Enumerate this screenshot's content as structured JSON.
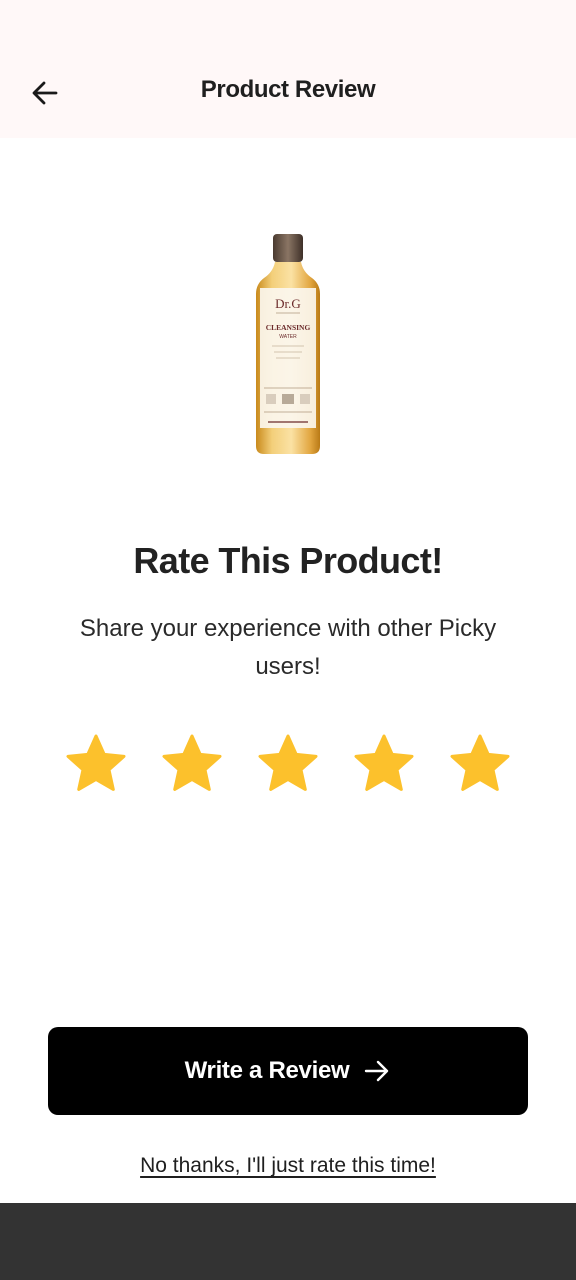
{
  "header": {
    "title": "Product Review",
    "back_icon": "arrow-left-icon"
  },
  "product": {
    "brand": "Dr.G",
    "name_line1": "CLEANSING",
    "name_line2": "WATER",
    "image_icon": "cleansing-water-bottle"
  },
  "rating": {
    "title": "Rate This Product!",
    "subtitle": "Share your experience with other Picky users!",
    "star_icon": "star-icon",
    "star_color": "#fcc12c",
    "selected": 5,
    "max": 5
  },
  "actions": {
    "write_review_label": "Write a Review",
    "write_review_icon": "arrow-right-icon",
    "skip_label": "No thanks, I'll just rate this time!"
  },
  "colors": {
    "header_bg": "#fff8f8",
    "button_bg": "#000000",
    "bottom_bar": "#333333"
  }
}
